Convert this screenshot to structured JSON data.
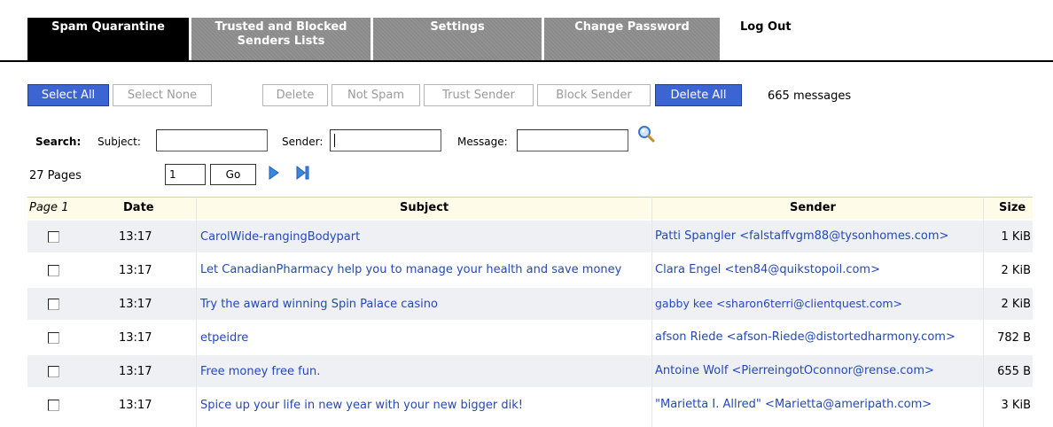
{
  "tabs": [
    {
      "label": "Spam Quarantine"
    },
    {
      "label": "Trusted and Blocked Senders Lists"
    },
    {
      "label": "Settings"
    },
    {
      "label": "Change Password"
    },
    {
      "label": "Log Out"
    }
  ],
  "toolbar": {
    "select_all": "Select All",
    "select_none": "Select None",
    "delete": "Delete",
    "not_spam": "Not Spam",
    "trust_sender": "Trust Sender",
    "block_sender": "Block Sender",
    "delete_all": "Delete All",
    "message_count": "665 messages"
  },
  "search": {
    "label": "Search:",
    "subject_label": "Subject:",
    "sender_label": "Sender:",
    "message_label": "Message:",
    "subject_value": "",
    "sender_value": "",
    "message_value": ""
  },
  "pager": {
    "pages_text": "27 Pages",
    "page_value": "1",
    "go_label": "Go"
  },
  "table": {
    "columns": {
      "page": "Page 1",
      "date": "Date",
      "subject": "Subject",
      "sender": "Sender",
      "size": "Size"
    },
    "rows": [
      {
        "date": "13:17",
        "subject": "CarolWide-rangingBodypart",
        "sender": "Patti Spangler <falstaffvgm88@tysonhomes.com>",
        "size": "1 KiB"
      },
      {
        "date": "13:17",
        "subject": "Let CanadianPharmacy help you to manage your health and save money",
        "sender": "Clara Engel <ten84@quikstopoil.com>",
        "size": "2 KiB"
      },
      {
        "date": "13:17",
        "subject": "Try the award winning Spin Palace casino",
        "sender": "gabby kee <sharon6terri@clientquest.com>",
        "size": "2 KiB"
      },
      {
        "date": "13:17",
        "subject": "etpeidre",
        "sender": "afson Riede <afson-Riede@distortedharmony.com>",
        "size": "782 B"
      },
      {
        "date": "13:17",
        "subject": "Free money free fun.",
        "sender": "Antoine Wolf <PierreingotOconnor@rense.com>",
        "size": "655 B"
      },
      {
        "date": "13:17",
        "subject": "Spice up your life in new year with your new bigger dik!",
        "sender": "\"Marietta I. Allred\" <Marietta@ameripath.com>",
        "size": "3 KiB"
      }
    ]
  },
  "icons": {
    "search": "magnifier-icon",
    "next": "next-page-icon",
    "last": "last-page-icon"
  },
  "colors": {
    "accent_blue": "#3c64d2",
    "link_blue": "#2448b8",
    "active_tab": "#000000",
    "inactive_tab": "#8a8a8a",
    "header_bg": "#fffbe9",
    "row_alt": "#eef0f4"
  }
}
